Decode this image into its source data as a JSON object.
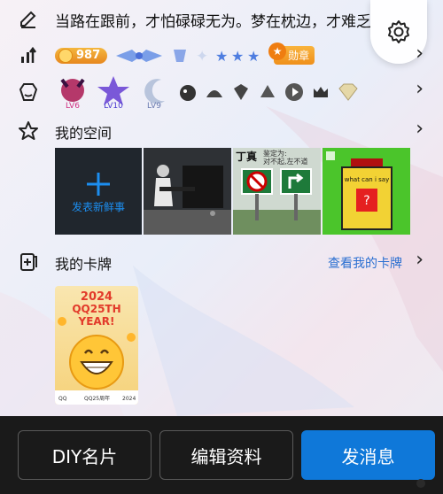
{
  "signature": {
    "text": "当路在跟前，才怕碌碌无为。梦在枕边，才难乏"
  },
  "badges": {
    "coin_value": "987",
    "medal_label": "勋章"
  },
  "levels": {
    "lv6": "LV6",
    "lv10": "LV10",
    "lv9": "LV9"
  },
  "space": {
    "title": "我的空间",
    "new_post_label": "发表新鲜事",
    "tile_traffic": {
      "sign_title": "丁真",
      "sign_line1": "鉴定为:",
      "sign_line2": "对不起,左不道"
    },
    "tile_game": {
      "label_top": "what can i say",
      "label_box": "?"
    }
  },
  "cards": {
    "title": "我的卡牌",
    "link": "查看我的卡牌",
    "card": {
      "year": "2024",
      "line1": "QQ25TH",
      "line2": "YEAR!",
      "footer_left": "QQ",
      "footer_mid": "QQ25周年",
      "footer_right": "2024"
    }
  },
  "actions": {
    "diy": "DIY名片",
    "edit": "编辑资料",
    "message": "发消息"
  }
}
